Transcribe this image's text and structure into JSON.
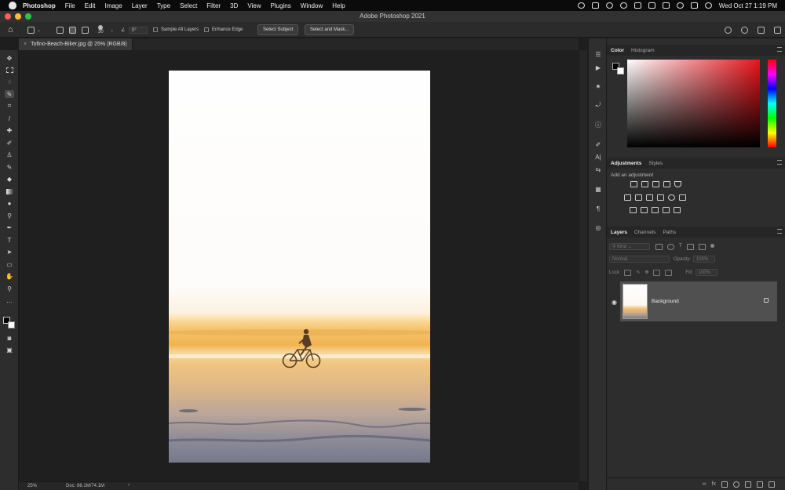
{
  "menubar": {
    "app": "Photoshop",
    "items": [
      "File",
      "Edit",
      "Image",
      "Layer",
      "Type",
      "Select",
      "Filter",
      "3D",
      "View",
      "Plugins",
      "Window",
      "Help"
    ],
    "clock": "Wed Oct 27  1:19 PM"
  },
  "window": {
    "title": "Adobe Photoshop 2021"
  },
  "options": {
    "brush_size": "30",
    "angle": "0°",
    "sample_all_layers": "Sample All Layers",
    "enhance_edge": "Enhance Edge",
    "select_subject": "Select Subject",
    "select_and_mask": "Select and Mask..."
  },
  "document": {
    "tab_title": "Tofino-Beach-Biker.jpg @ 25% (RGB/8)",
    "zoom": "25%",
    "doc_size": "Doc: 86.1M/74.1M"
  },
  "panels": {
    "color_tabs": [
      "Color",
      "Histogram"
    ],
    "adjust_tabs": [
      "Adjustments",
      "Styles"
    ],
    "add_adjustment": "Add an adjustment",
    "layer_tabs": [
      "Layers",
      "Channels",
      "Paths"
    ],
    "kind": "Kind",
    "blend_mode": "Normal",
    "opacity_label": "Opacity:",
    "opacity_value": "100%",
    "lock_label": "Lock:",
    "fill_label": "Fill:",
    "fill_value": "100%",
    "layer_name": "Background"
  },
  "colors": {
    "accent": "#e8141c",
    "bg": "#1e1e1e"
  }
}
